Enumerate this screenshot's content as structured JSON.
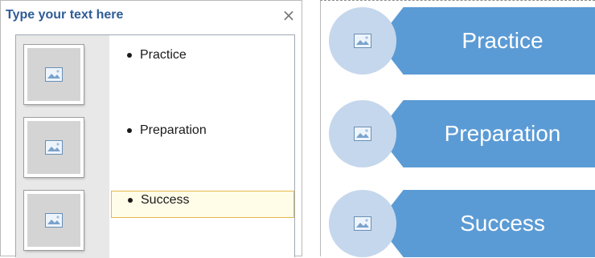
{
  "text_pane": {
    "title": "Type your text here",
    "close_glyph": "×",
    "items": [
      {
        "label": "Practice",
        "icon": "picture-placeholder-icon"
      },
      {
        "label": "Preparation",
        "icon": "picture-placeholder-icon"
      },
      {
        "label": "Success",
        "icon": "picture-placeholder-icon"
      }
    ]
  },
  "diagram": {
    "shapes": [
      {
        "label": "Practice"
      },
      {
        "label": "Preparation"
      },
      {
        "label": "Success"
      }
    ]
  },
  "colors": {
    "accent_blue": "#5b9bd5",
    "circle_fill": "#c5d7ec",
    "title_blue": "#2e5c97",
    "selection_border": "#e6b84e"
  }
}
